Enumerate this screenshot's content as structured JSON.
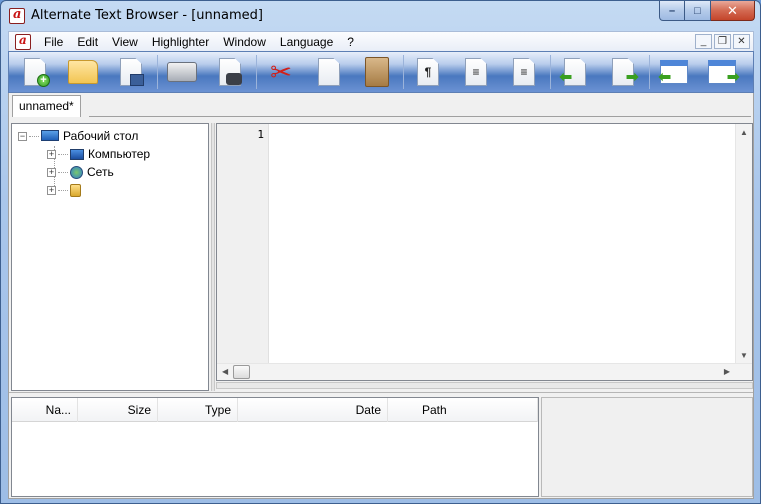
{
  "window": {
    "title": "Alternate Text Browser  - [unnamed]"
  },
  "menu": {
    "items": [
      "File",
      "Edit",
      "View",
      "Highlighter",
      "Window",
      "Language",
      "?"
    ]
  },
  "tabs": [
    {
      "label": "unnamed*"
    }
  ],
  "tree": {
    "root": "Рабочий стол",
    "children": [
      "Компьютер",
      "Сеть"
    ]
  },
  "editor": {
    "line_numbers": [
      "1"
    ]
  },
  "file_list": {
    "columns": [
      "Na...",
      "Size",
      "Type",
      "Date",
      "Path"
    ]
  },
  "colors": {
    "accent": "#4a78bf",
    "close_button": "#c4452b"
  }
}
